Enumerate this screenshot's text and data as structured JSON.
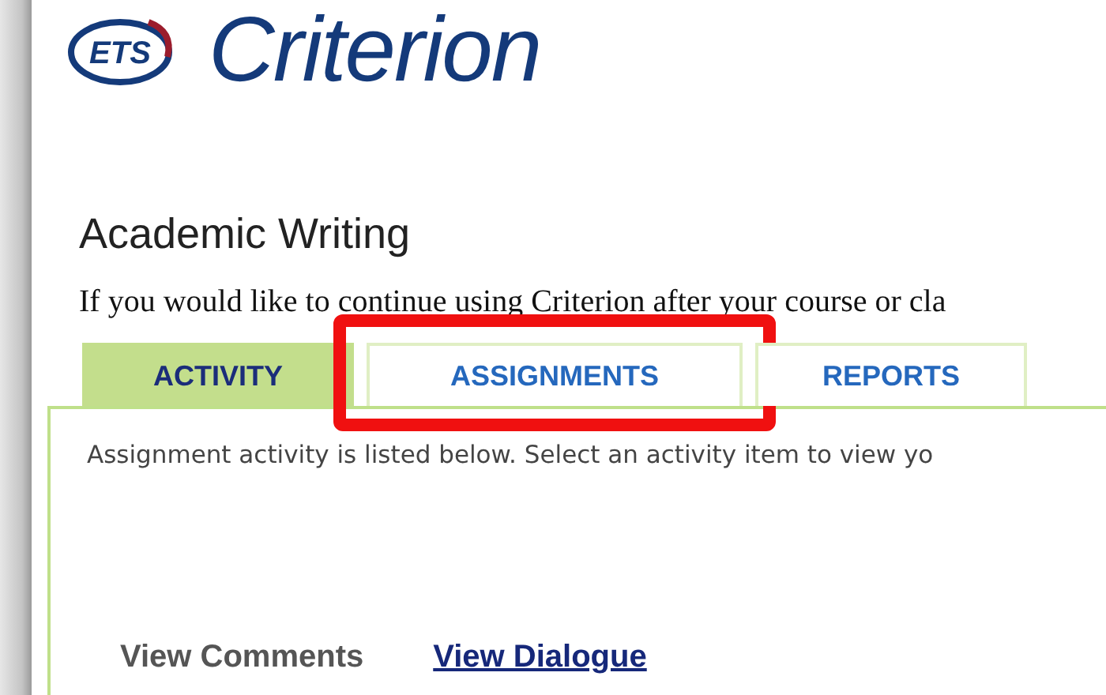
{
  "logo": {
    "mark": "ETS",
    "name": "Criterion"
  },
  "heading": "Academic Writing",
  "notice": "If you would like to continue using Criterion after your course or cla",
  "tabs": [
    {
      "label": "ACTIVITY",
      "selected": true,
      "highlighted": false
    },
    {
      "label": "ASSIGNMENTS",
      "selected": false,
      "highlighted": true
    },
    {
      "label": "REPORTS",
      "selected": false,
      "highlighted": false
    }
  ],
  "panel": {
    "intro": "Assignment activity is listed below. Select an activity item to view yo",
    "actions": [
      {
        "label": "View Comments",
        "kind": "text"
      },
      {
        "label": "View Dialogue",
        "kind": "link"
      }
    ]
  }
}
